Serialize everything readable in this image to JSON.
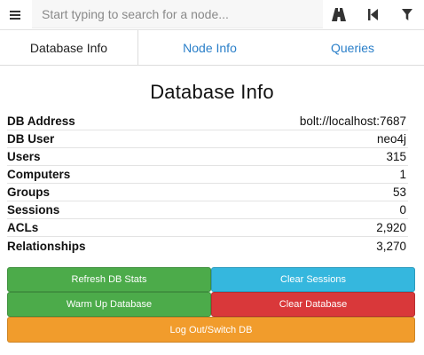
{
  "search": {
    "placeholder": "Start typing to search for a node...",
    "value": ""
  },
  "icons": {
    "menu": "hamburger-menu-icon",
    "path": "road-path-icon",
    "back": "step-backward-icon",
    "filter": "filter-icon"
  },
  "tabs": [
    {
      "label": "Database Info",
      "active": true
    },
    {
      "label": "Node Info",
      "active": false
    },
    {
      "label": "Queries",
      "active": false
    }
  ],
  "main": {
    "title": "Database Info",
    "rows": [
      {
        "key": "DB Address",
        "value": "bolt://localhost:7687"
      },
      {
        "key": "DB User",
        "value": "neo4j"
      },
      {
        "key": "Users",
        "value": "315"
      },
      {
        "key": "Computers",
        "value": "1"
      },
      {
        "key": "Groups",
        "value": "53"
      },
      {
        "key": "Sessions",
        "value": "0"
      },
      {
        "key": "ACLs",
        "value": "2,920"
      },
      {
        "key": "Relationships",
        "value": "3,270"
      }
    ]
  },
  "buttons": {
    "refresh": "Refresh DB Stats",
    "clear_sessions": "Clear Sessions",
    "warm_up": "Warm Up Database",
    "clear_database": "Clear Database",
    "logout": "Log Out/Switch DB"
  },
  "colors": {
    "link": "#2a7fc9",
    "success": "#4cab4a",
    "info": "#35b7de",
    "danger": "#d9383a",
    "warning": "#f19c2c"
  }
}
